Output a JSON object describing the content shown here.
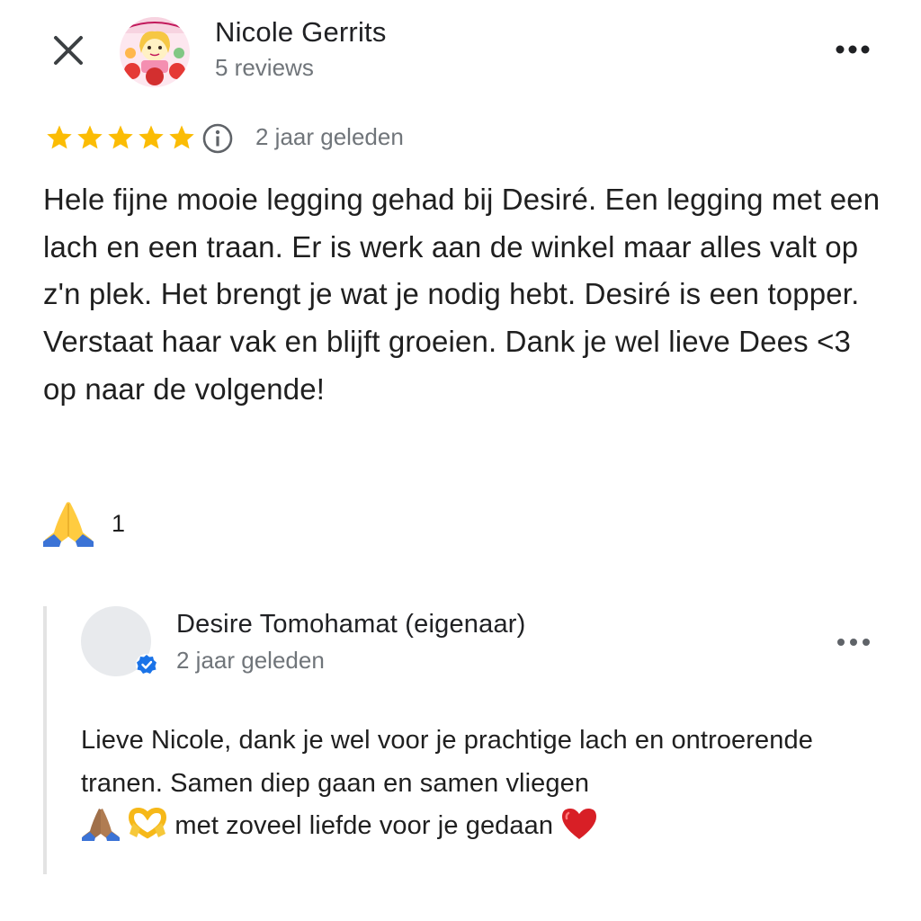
{
  "header": {
    "close_icon": "close-icon",
    "reviewer_name": "Nicole Gerrits",
    "reviewer_count": "5 reviews",
    "more_icon": "more-horizontal-icon"
  },
  "review": {
    "rating": 5,
    "rating_max": 5,
    "star_color": "#fbbc04",
    "info_icon": "info-icon",
    "date": "2 jaar geleden",
    "text": "Hele fijne mooie legging gehad bij Desiré. Een legging met een lach en een traan. Er is werk aan de winkel maar alles valt op z'n plek. Het brengt je wat je nodig hebt. Desiré is een topper. Verstaat haar vak en blijft groeien. Dank je wel lieve Dees <3 op naar de volgende!",
    "reaction": {
      "icon": "folded-hands-icon",
      "count": "1"
    }
  },
  "owner_reply": {
    "name": "Desire Tomohamat (eigenaar)",
    "verified_icon": "verified-badge-icon",
    "verified_color": "#1a73e8",
    "date": "2 jaar geleden",
    "more_icon": "more-horizontal-icon",
    "text_part1": "Lieve Nicole, dank je wel voor je prachtige lach en ontroerende tranen. Samen diep gaan en samen vliegen",
    "text_part2": "met zoveel liefde voor je gedaan",
    "emojis": [
      "folded-hands-icon",
      "heart-hands-icon",
      "red-heart-icon"
    ]
  }
}
